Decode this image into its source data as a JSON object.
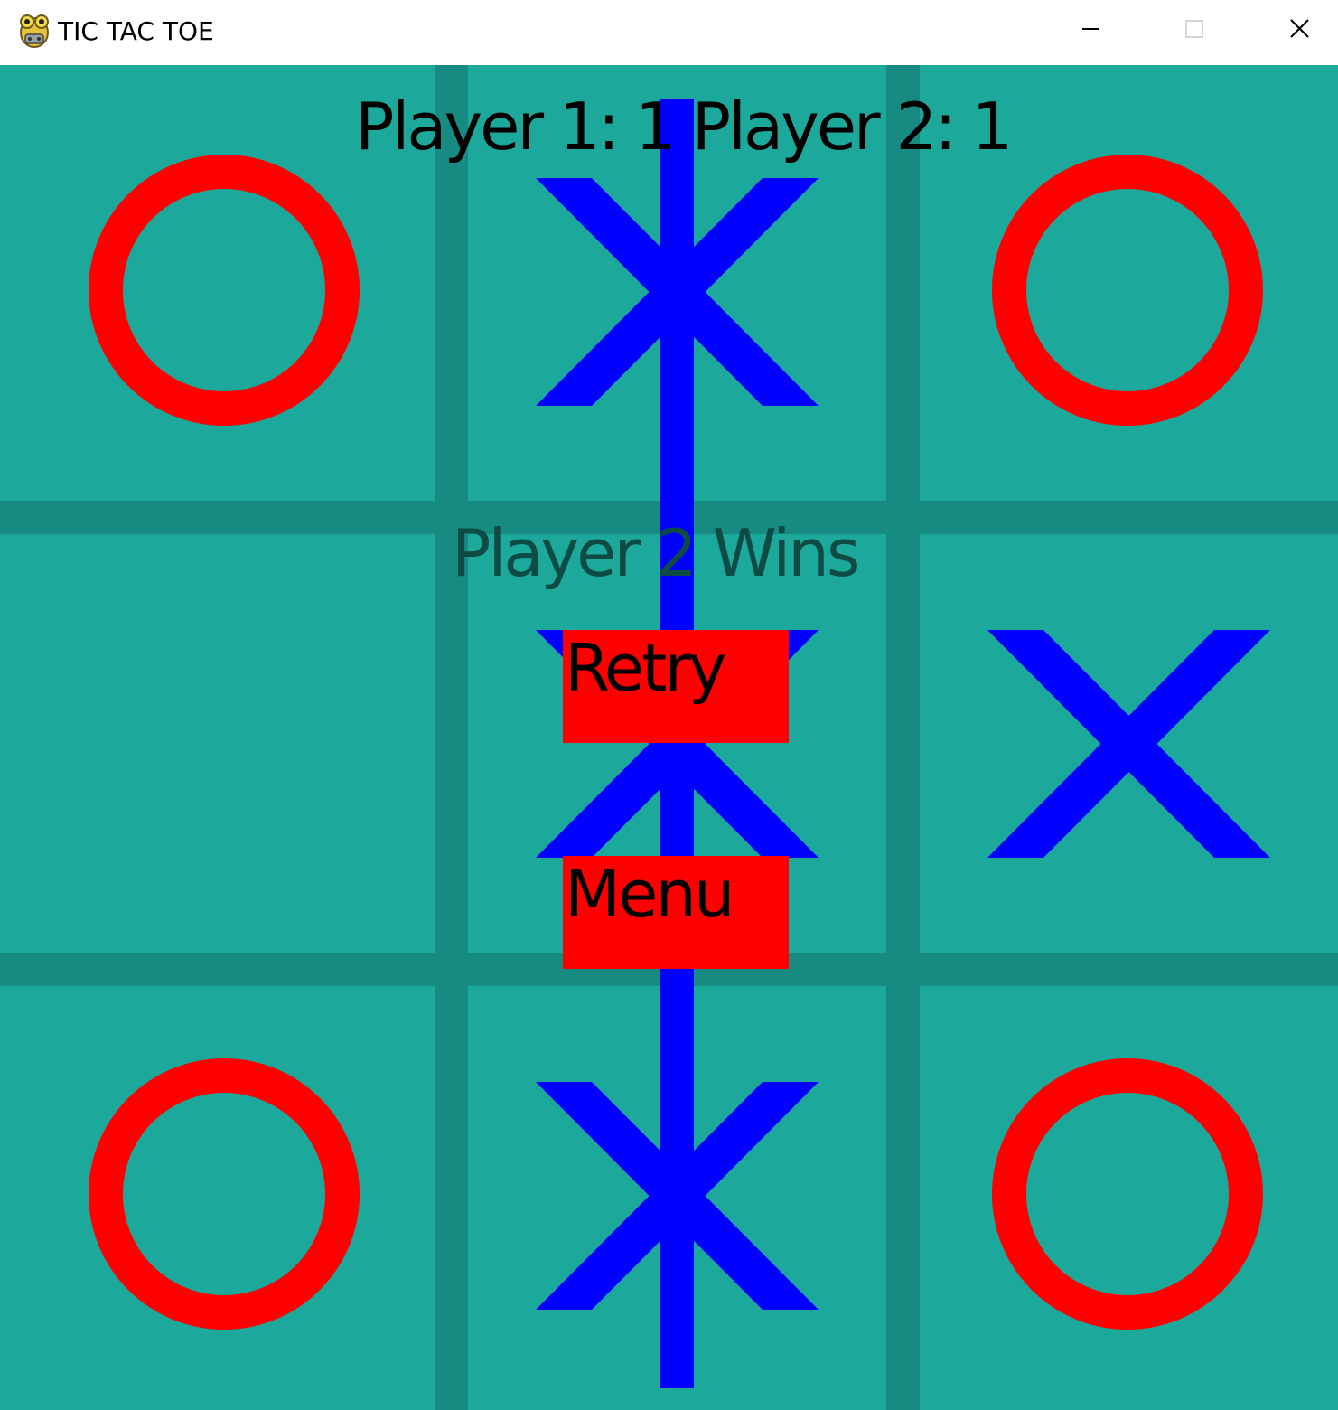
{
  "window": {
    "title": "TIC TAC TOE",
    "icon": "pygame-snake-icon",
    "controls": [
      "minimize-icon",
      "maximize-icon",
      "close-icon"
    ]
  },
  "colors": {
    "background": "#1ca89b",
    "grid_line": "#178b81",
    "x_mark": "#0000ff",
    "o_mark": "#ff0000",
    "button": "#ff0000",
    "win_line": "#0000ff"
  },
  "board": {
    "cells": [
      [
        "O",
        "X",
        "O"
      ],
      [
        "",
        "X",
        "X"
      ],
      [
        "O",
        "X",
        "O"
      ]
    ],
    "winning_line": "middle-column"
  },
  "score": {
    "text": "Player 1: 1 Player 2: 1"
  },
  "result": {
    "text": "Player 2 Wins"
  },
  "buttons": {
    "retry": "Retry",
    "menu": "Menu"
  }
}
